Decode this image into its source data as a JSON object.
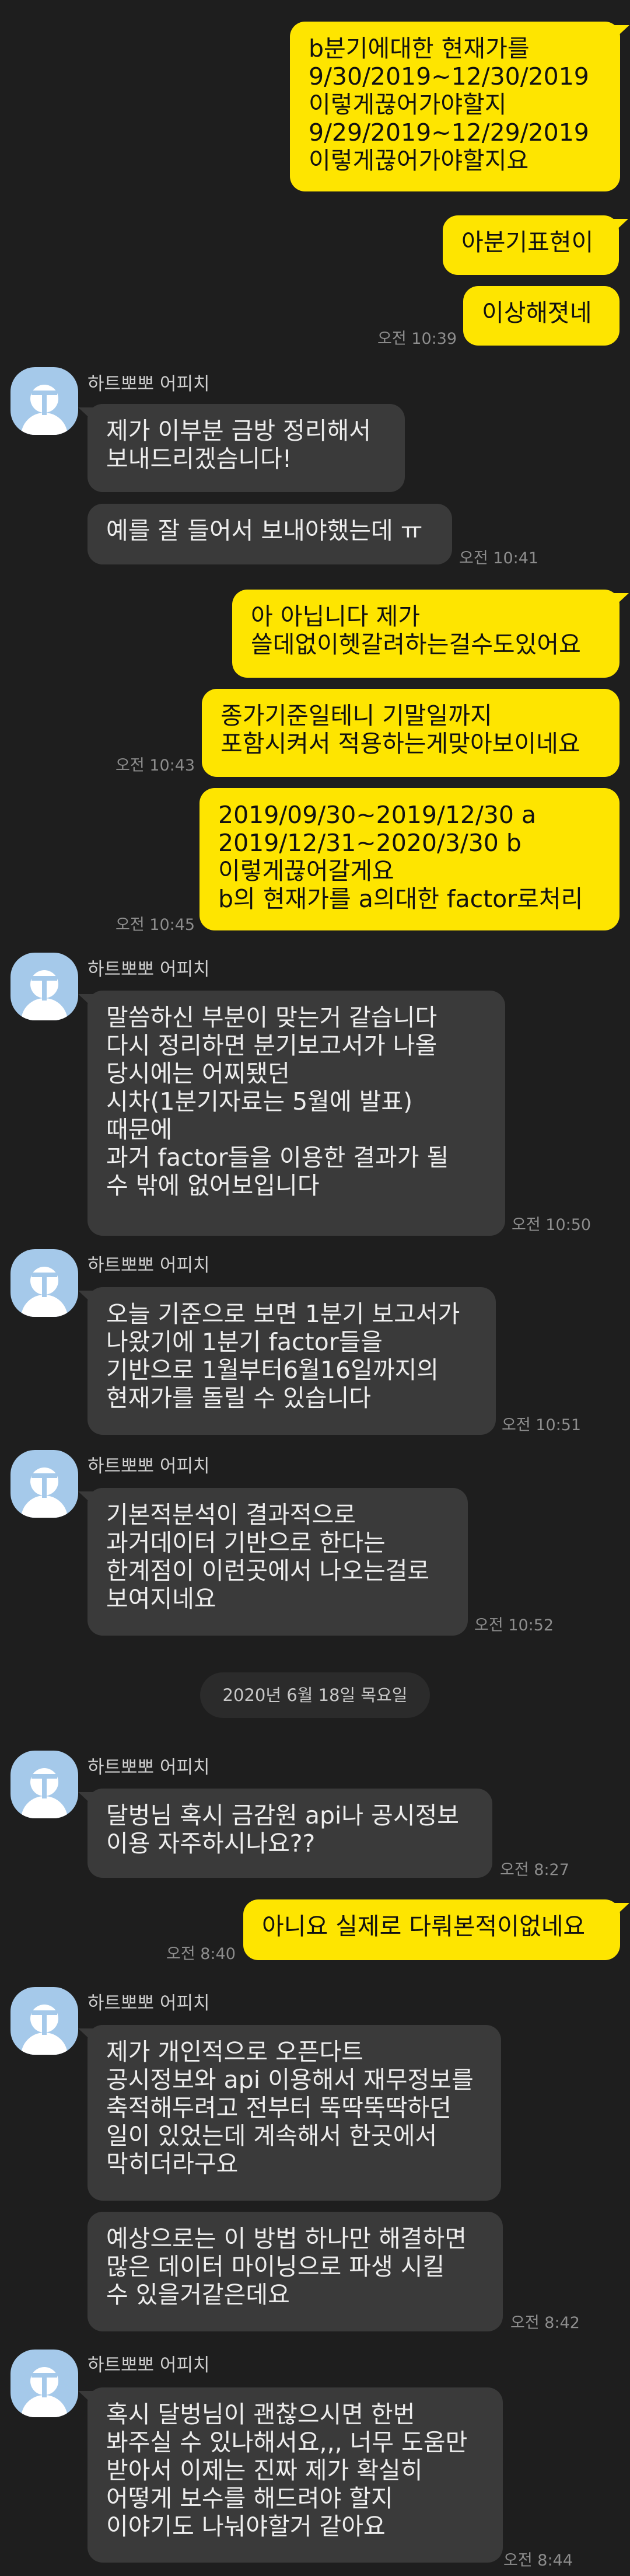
{
  "sender_name": "하트뽀뽀 어피치",
  "date_divider": "2020년 6월 18일 목요일",
  "messages": [
    {
      "text": "b분기에대한 현재가를\n9/30/2019~12/30/2019\n이렇게끊어가야할지\n9/29/2019~12/29/2019\n이렇게끊어가야할지요",
      "side": "me"
    },
    {
      "text": "아분기표현이",
      "side": "me"
    },
    {
      "text": "이상해졋네",
      "side": "me",
      "time": "오전 10:39"
    },
    {
      "text": "제가 이부분 금방 정리해서\n보내드리겠슴니다!",
      "side": "them"
    },
    {
      "text": "예를 잘 들어서 보내야했는데 ㅠ",
      "side": "them",
      "time": "오전 10:41"
    },
    {
      "text": "아 아닙니다 제가\n쓸데없이헷갈려하는걸수도있어요",
      "side": "me"
    },
    {
      "text": "종가기준일테니 기말일까지\n포함시켜서 적용하는게맞아보이네요",
      "side": "me",
      "time": "오전 10:43"
    },
    {
      "text": "2019/09/30~2019/12/30 a\n2019/12/31~2020/3/30 b\n이렇게끊어갈게요\nb의 현재가를  a의대한 factor로처리",
      "side": "me",
      "time": "오전 10:45"
    },
    {
      "text": "말씀하신 부분이 맞는거 같습니다\n다시 정리하면 분기보고서가 나올\n당시에는 어찌됐던\n시차(1분기자료는 5월에 발표)\n때문에\n과거 factor들을 이용한 결과가 될\n수 밖에 없어보입니다",
      "side": "them",
      "time": "오전 10:50"
    },
    {
      "text": "오늘 기준으로 보면 1분기 보고서가\n나왔기에 1분기 factor들을\n기반으로 1월부터6월16일까지의\n현재가를 돌릴 수 있습니다",
      "side": "them",
      "time": "오전 10:51"
    },
    {
      "text": "기본적분석이 결과적으로\n과거데이터 기반으로 한다는\n한계점이 이런곳에서 나오는걸로\n보여지네요",
      "side": "them",
      "time": "오전 10:52"
    },
    {
      "text": "달벙님 혹시 금감원 api나 공시정보\n이용 자주하시나요??",
      "side": "them",
      "time": "오전 8:27"
    },
    {
      "text": "아니요 실제로 다뤄본적이없네요",
      "side": "me",
      "time": "오전 8:40"
    },
    {
      "text": "제가 개인적으로 오픈다트\n공시정보와 api 이용해서 재무정보를\n축적해두려고 전부터 뚝딱뚝딱하던\n일이 있었는데 계속해서 한곳에서\n막히더라구요",
      "side": "them"
    },
    {
      "text": "예상으로는 이 방법 하나만 해결하면\n많은 데이터 마이닝으로 파생 시킬\n수 있을거같은데요",
      "side": "them",
      "time": "오전 8:42"
    },
    {
      "text": "혹시 달벙님이 괜찮으시면 한번\n봐주실 수 있나해서요,,, 너무 도움만\n받아서 이제는 진짜 제가 확실히\n어떻게 보수를 해드려야 할지\n이야기도 나눠야할거 같아요",
      "side": "them",
      "time": "오전 8:44"
    }
  ]
}
